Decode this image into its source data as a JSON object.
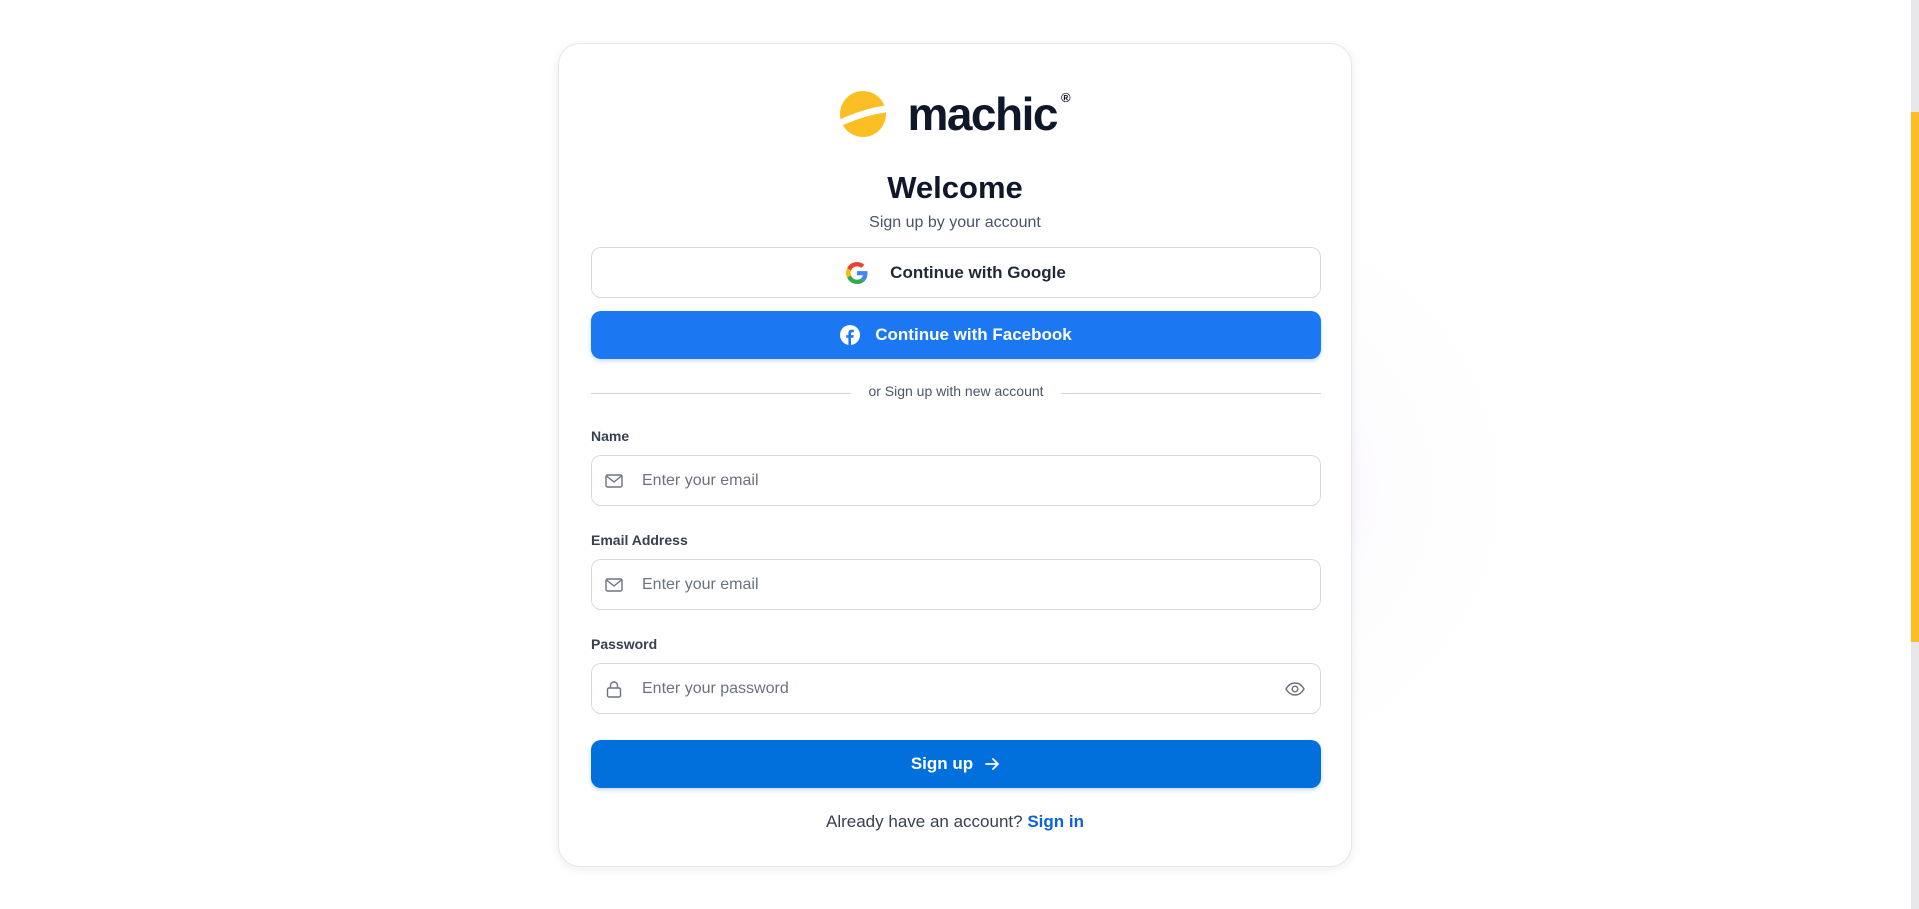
{
  "brand": {
    "name": "machic",
    "registered_mark": "®",
    "logo_color": "#fbbf24"
  },
  "header": {
    "title": "Welcome",
    "subtitle": "Sign up by your account"
  },
  "social": {
    "google_label": "Continue with Google",
    "facebook_label": "Continue with Facebook",
    "facebook_color": "#1b77f2"
  },
  "divider": {
    "text": "or Sign up with new account"
  },
  "form": {
    "name": {
      "label": "Name",
      "placeholder": "Enter your email",
      "icon": "mail-icon"
    },
    "email": {
      "label": "Email Address",
      "placeholder": "Enter your email",
      "icon": "mail-icon"
    },
    "password": {
      "label": "Password",
      "placeholder": "Enter your password",
      "icon": "lock-icon",
      "toggle_icon": "eye-icon"
    },
    "submit_label": "Sign up",
    "submit_color": "#0270dc"
  },
  "footer": {
    "prompt": "Already have an account?",
    "link_label": "Sign in"
  },
  "scrollbar": {
    "thumb_color": "#fbbf24"
  }
}
